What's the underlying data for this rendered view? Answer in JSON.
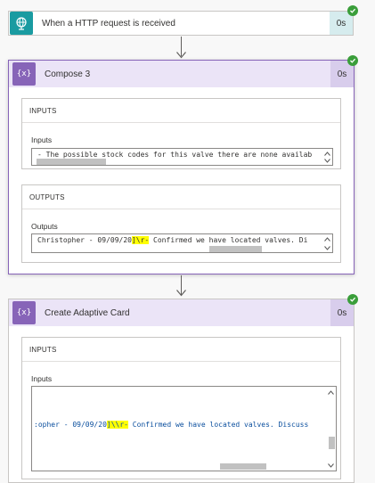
{
  "trigger": {
    "title": "When a HTTP request is received",
    "duration": "0s"
  },
  "compose": {
    "title": "Compose 3",
    "duration": "0s",
    "inputs_header": "INPUTS",
    "inputs_label": "Inputs",
    "inputs_value": "- The possible stock codes for this valve there are none availab",
    "outputs_header": "OUTPUTS",
    "outputs_label": "Outputs",
    "outputs_pre": "Christopher  -  09/09/20",
    "outputs_hl": "]\\r-",
    "outputs_post": "  Confirmed we have located valves. Di"
  },
  "adaptive": {
    "title": "Create Adaptive Card",
    "duration": "0s",
    "inputs_header": "INPUTS",
    "inputs_label": "Inputs",
    "inputs_pre": ":opher  -  09/09/20",
    "inputs_hl": "]\\\\r-",
    "inputs_post": "  Confirmed we have located valves. Discuss"
  },
  "colors": {
    "trigger": "#1a9ba1",
    "compose": "#8764b8",
    "compose_light": "#ebe4f7",
    "trigger_light": "#d6ecee",
    "success": "#3a9e3a"
  }
}
